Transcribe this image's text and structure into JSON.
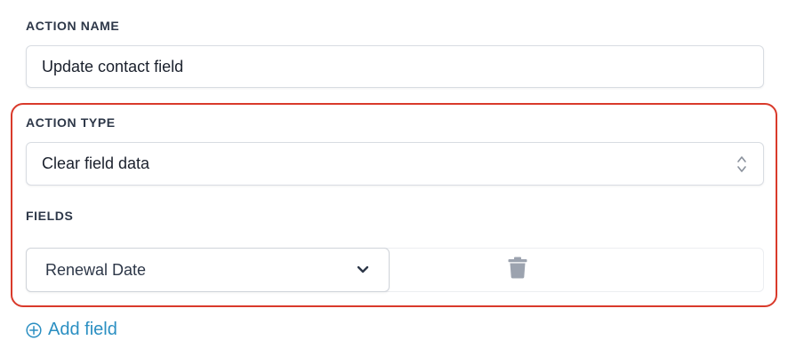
{
  "action_name": {
    "label": "ACTION NAME",
    "value": "Update contact field"
  },
  "action_type": {
    "label": "ACTION TYPE",
    "selected": "Clear field data"
  },
  "fields": {
    "label": "FIELDS",
    "items": [
      {
        "selected": "Renewal Date"
      }
    ],
    "add_label": "Add field"
  },
  "colors": {
    "highlight_border": "#d93a2b",
    "link": "#2b8fc2",
    "label_text": "#2d3748",
    "icon_gray": "#9ca3af"
  },
  "icons": {
    "select_arrows": "chevron-up-down-icon",
    "dropdown": "chevron-down-icon",
    "delete": "trash-icon",
    "add": "plus-circle-icon"
  }
}
